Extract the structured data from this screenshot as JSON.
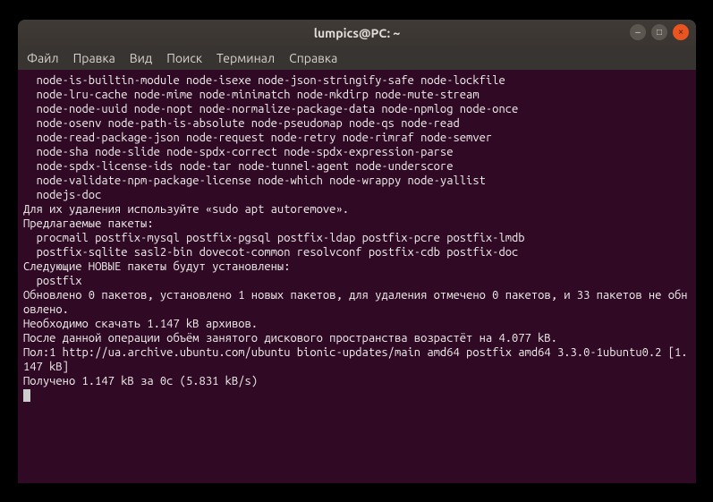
{
  "window": {
    "title": "lumpics@PC: ~"
  },
  "menu": {
    "file": "Файл",
    "edit": "Правка",
    "view": "Вид",
    "search": "Поиск",
    "terminal": "Терминал",
    "help": "Справка"
  },
  "output": {
    "pkg_line1": "  node-is-builtin-module node-isexe node-json-stringify-safe node-lockfile",
    "pkg_line2": "  node-lru-cache node-mime node-minimatch node-mkdirp node-mute-stream",
    "pkg_line3": "  node-node-uuid node-nopt node-normalize-package-data node-npmlog node-once",
    "pkg_line4": "  node-osenv node-path-is-absolute node-pseudomap node-qs node-read",
    "pkg_line5": "  node-read-package-json node-request node-retry node-rimraf node-semver",
    "pkg_line6": "  node-sha node-slide node-spdx-correct node-spdx-expression-parse",
    "pkg_line7": "  node-spdx-license-ids node-tar node-tunnel-agent node-underscore",
    "pkg_line8": "  node-validate-npm-package-license node-which node-wrappy node-yallist",
    "pkg_line9": "  nodejs-doc",
    "autoremove": "Для их удаления используйте «sudo apt autoremove».",
    "suggested_header": "Предлагаемые пакеты:",
    "suggested_line1": "  procmail postfix-mysql postfix-pgsql postfix-ldap postfix-pcre postfix-lmdb",
    "suggested_line2": "  postfix-sqlite sasl2-bin dovecot-common resolvconf postfix-cdb postfix-doc",
    "new_header": "Следующие НОВЫЕ пакеты будут установлены:",
    "new_line1": "  postfix",
    "summary1": "Обновлено 0 пакетов, установлено 1 новых пакетов, для удаления отмечено 0 пакетов, и 33 пакетов не обновлено.",
    "need_get": "Необходимо скачать 1.147 kB архивов.",
    "after_op": "После данной операции объём занятого дискового пространства возрастёт на 4.077 kB.",
    "get1": "Пол:1 http://ua.archive.ubuntu.com/ubuntu bionic-updates/main amd64 postfix amd64 3.3.0-1ubuntu0.2 [1.147 kB]",
    "fetched": "Получено 1.147 kB за 0с (5.831 kB/s)"
  }
}
